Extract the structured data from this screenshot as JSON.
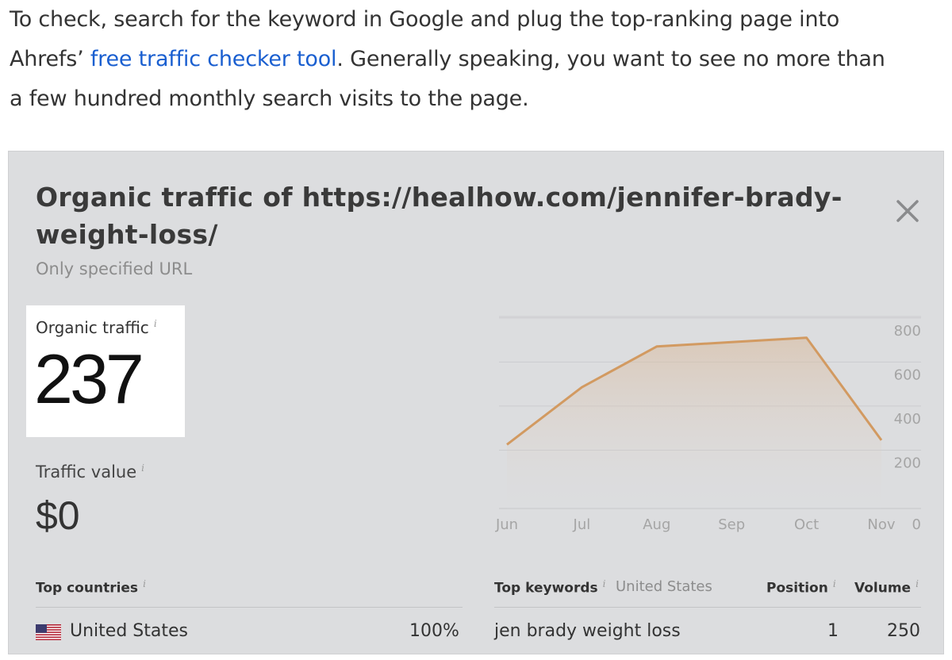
{
  "article": {
    "line1": "To check, search for the keyword in Google and plug the top-ranking page into",
    "line2_before": "Ahrefs’ ",
    "link_text": "free traffic checker tool",
    "line2_after": ". Generally speaking, you want to see no more than",
    "line3": "a few hundred monthly search visits to the page."
  },
  "panel": {
    "title_line1": "Organic traffic of https://healhow.com/jennifer-brady-",
    "title_line2": "weight-loss/",
    "subtitle": "Only specified URL",
    "close_icon": "close-icon",
    "info_glyph": "i",
    "organic_traffic_label": "Organic traffic",
    "organic_traffic_value": "237",
    "traffic_value_label": "Traffic value",
    "traffic_value": "$0"
  },
  "chart_data": {
    "type": "area",
    "x": [
      "Jun",
      "Jul",
      "Aug",
      "Sep",
      "Oct",
      "Nov"
    ],
    "y": [
      290,
      550,
      735,
      755,
      775,
      310
    ],
    "y_ticks": [
      "800",
      "600",
      "400",
      "200",
      "0"
    ],
    "ylim": [
      0,
      900
    ],
    "grid": true,
    "color": "#d29a61"
  },
  "countries": {
    "header": "Top countries",
    "rows": [
      {
        "flag": "us-flag-icon",
        "name": "United States",
        "share": "100%"
      }
    ]
  },
  "keywords": {
    "header": "Top keywords",
    "country": "United States",
    "col_position": "Position",
    "col_volume": "Volume",
    "rows": [
      {
        "keyword": "jen brady weight loss",
        "position": "1",
        "volume": "250"
      }
    ]
  },
  "colors": {
    "panel_bg": "#dcdddf",
    "link": "#1a5fd0",
    "line": "#d29a61"
  }
}
